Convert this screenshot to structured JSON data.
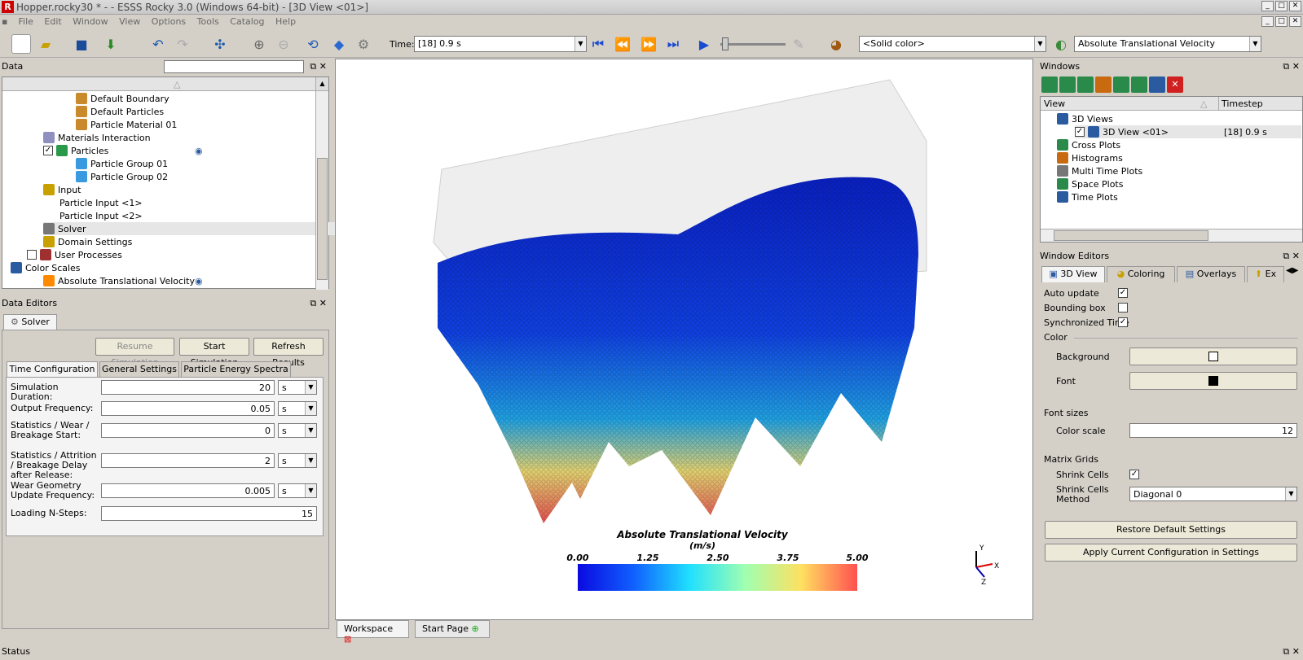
{
  "window": {
    "title": "Hopper.rocky30 * - - ESSS Rocky 3.0 (Windows 64-bit) - [3D View <01>]"
  },
  "menu": [
    "File",
    "Edit",
    "Window",
    "View",
    "Options",
    "Tools",
    "Catalog",
    "Help"
  ],
  "toolbar": {
    "time_label": "Time:",
    "time_value": "[18] 0.9 s",
    "color_mode": "<Solid color>",
    "property": "Absolute Translational Velocity"
  },
  "data_panel": {
    "title": "Data",
    "search_placeholder": "",
    "tree": [
      {
        "label": "Default Boundary",
        "indent": 4,
        "icon": "boundary-icon"
      },
      {
        "label": "Default Particles",
        "indent": 4,
        "icon": "particles-icon"
      },
      {
        "label": "Particle Material 01",
        "indent": 4,
        "icon": "material-icon"
      },
      {
        "label": "Materials Interaction",
        "indent": 2,
        "icon": "interaction-icon"
      },
      {
        "label": "Particles",
        "indent": 2,
        "icon": "particles-group-icon"
      },
      {
        "label": "Particle Group 01",
        "indent": 4,
        "icon": "particle-group-icon"
      },
      {
        "label": "Particle Group 02",
        "indent": 4,
        "icon": "particle-group-icon"
      },
      {
        "label": "Input",
        "indent": 2,
        "icon": "input-icon"
      },
      {
        "label": "Particle Input <1>",
        "indent": 3,
        "icon": ""
      },
      {
        "label": "Particle Input <2>",
        "indent": 3,
        "icon": ""
      },
      {
        "label": "Solver",
        "indent": 2,
        "icon": "solver-icon"
      },
      {
        "label": "Domain Settings",
        "indent": 2,
        "icon": "domain-icon"
      },
      {
        "label": "User Processes",
        "indent": 1,
        "icon": "processes-icon"
      },
      {
        "label": "Color Scales",
        "indent": 0,
        "icon": "color-scales-icon"
      },
      {
        "label": "Absolute Translational Velocity",
        "indent": 2,
        "icon": "scale-icon"
      }
    ]
  },
  "data_editors": {
    "title": "Data Editors",
    "tab": "Solver",
    "buttons": {
      "resume": "Resume Simulation",
      "start": "Start Simulation",
      "refresh": "Refresh Results"
    },
    "subtabs": [
      "Time Configuration",
      "General Settings",
      "Particle Energy Spectra"
    ],
    "fields": [
      {
        "label": "Simulation Duration:",
        "value": "20",
        "unit": "s"
      },
      {
        "label": "Output Frequency:",
        "value": "0.05",
        "unit": "s"
      },
      {
        "label": "Statistics / Wear / Breakage Start:",
        "value": "0",
        "unit": "s"
      },
      {
        "label": "Statistics / Attrition / Breakage Delay after Release:",
        "value": "2",
        "unit": "s"
      },
      {
        "label": "Wear Geometry Update Frequency:",
        "value": "0.005",
        "unit": "s"
      },
      {
        "label": "Loading N-Steps:",
        "value": "15",
        "unit": ""
      }
    ]
  },
  "viewport": {
    "legend_title": "Absolute Translational Velocity",
    "legend_unit": "(m/s)",
    "ticks": [
      "0.00",
      "1.25",
      "2.50",
      "3.75",
      "5.00"
    ],
    "axis_y": "Y",
    "axis_x": "X",
    "axis_z": "Z"
  },
  "workspace_tabs": {
    "workspace": "Workspace",
    "start_page": "Start Page"
  },
  "windows_panel": {
    "title": "Windows",
    "col_view": "View",
    "col_timestep": "Timestep",
    "tree": [
      {
        "label": "3D Views",
        "timestep": ""
      },
      {
        "label": "3D View <01>",
        "timestep": "[18] 0.9 s"
      },
      {
        "label": "Cross Plots",
        "timestep": ""
      },
      {
        "label": "Histograms",
        "timestep": ""
      },
      {
        "label": "Multi Time Plots",
        "timestep": ""
      },
      {
        "label": "Space Plots",
        "timestep": ""
      },
      {
        "label": "Time Plots",
        "timestep": ""
      }
    ]
  },
  "window_editors": {
    "title": "Window Editors",
    "tabs": [
      "3D View",
      "Coloring",
      "Overlays",
      "Ex"
    ],
    "auto_update": "Auto update",
    "bounding_box": "Bounding box",
    "synchronized_time": "Synchronized Time",
    "color_section": "Color",
    "background": "Background",
    "font": "Font",
    "font_sizes": "Font sizes",
    "color_scale": "Color scale",
    "color_scale_value": "12",
    "matrix_grids": "Matrix Grids",
    "shrink_cells": "Shrink Cells",
    "shrink_method": "Shrink Cells Method",
    "shrink_method_value": "Diagonal 0",
    "restore": "Restore Default Settings",
    "apply": "Apply Current Configuration in Settings"
  },
  "status": {
    "title": "Status"
  }
}
